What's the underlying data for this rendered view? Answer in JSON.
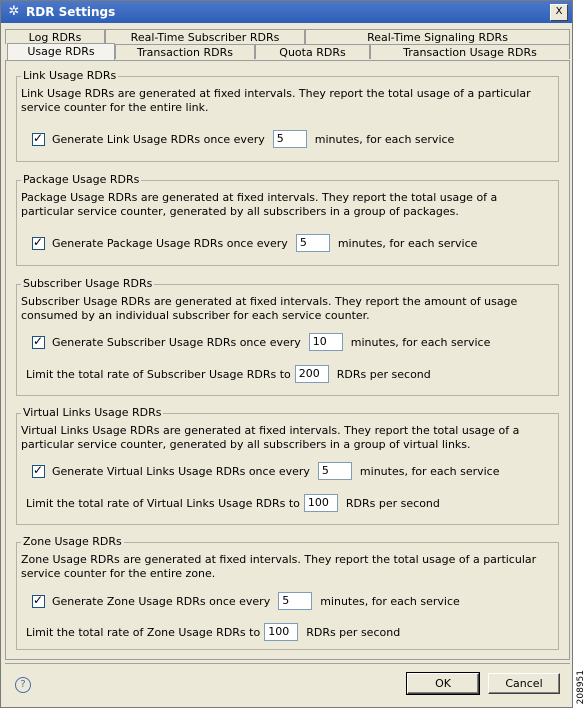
{
  "window": {
    "title": "RDR Settings",
    "close": "X"
  },
  "tabs_row1": [
    "Log RDRs",
    "Real-Time Subscriber RDRs",
    "Real-Time Signaling RDRs"
  ],
  "tabs_row2": [
    "Usage RDRs",
    "Transaction RDRs",
    "Quota RDRs",
    "Transaction Usage RDRs"
  ],
  "active_tab": "Usage RDRs",
  "groups": {
    "link": {
      "title": "Link Usage RDRs",
      "desc": "Link Usage RDRs are generated at fixed intervals. They report the total usage of a particular service counter for the entire link.",
      "generate_label": "Generate Link Usage RDRs once every",
      "generate_value": "5",
      "generate_suffix": "minutes, for each service"
    },
    "package": {
      "title": "Package Usage RDRs",
      "desc": "Package Usage RDRs are generated at fixed intervals. They report the total usage of a particular service counter, generated by all subscribers in a group of packages.",
      "generate_label": "Generate Package Usage RDRs once every",
      "generate_value": "5",
      "generate_suffix": "minutes, for each service"
    },
    "subscriber": {
      "title": "Subscriber Usage RDRs",
      "desc": "Subscriber Usage RDRs are generated at fixed intervals. They report the amount of usage consumed by an individual subscriber for each service counter.",
      "generate_label": "Generate Subscriber Usage RDRs once every",
      "generate_value": "10",
      "generate_suffix": "minutes, for each service",
      "limit_label": "Limit the total rate of Subscriber Usage RDRs to",
      "limit_value": "200",
      "limit_suffix": "RDRs per second"
    },
    "virtual": {
      "title": "Virtual Links Usage RDRs",
      "desc": "Virtual Links Usage RDRs are generated at fixed intervals. They report the total usage of a particular service counter, generated by all subscribers in a group of virtual links.",
      "generate_label": "Generate Virtual Links Usage RDRs once every",
      "generate_value": "5",
      "generate_suffix": "minutes, for each service",
      "limit_label": "Limit the total rate of Virtual Links Usage RDRs to",
      "limit_value": "100",
      "limit_suffix": "RDRs per second"
    },
    "zone": {
      "title": "Zone Usage RDRs",
      "desc": "Zone Usage RDRs are generated at fixed intervals. They report the total usage of a particular service counter for the entire zone.",
      "generate_label": "Generate Zone Usage RDRs once every",
      "generate_value": "5",
      "generate_suffix": "minutes, for each service",
      "limit_label": "Limit the total rate of Zone Usage RDRs to",
      "limit_value": "100",
      "limit_suffix": "RDRs per second"
    }
  },
  "buttons": {
    "ok": "OK",
    "cancel": "Cancel",
    "help": "?"
  },
  "figure_code": "208951"
}
